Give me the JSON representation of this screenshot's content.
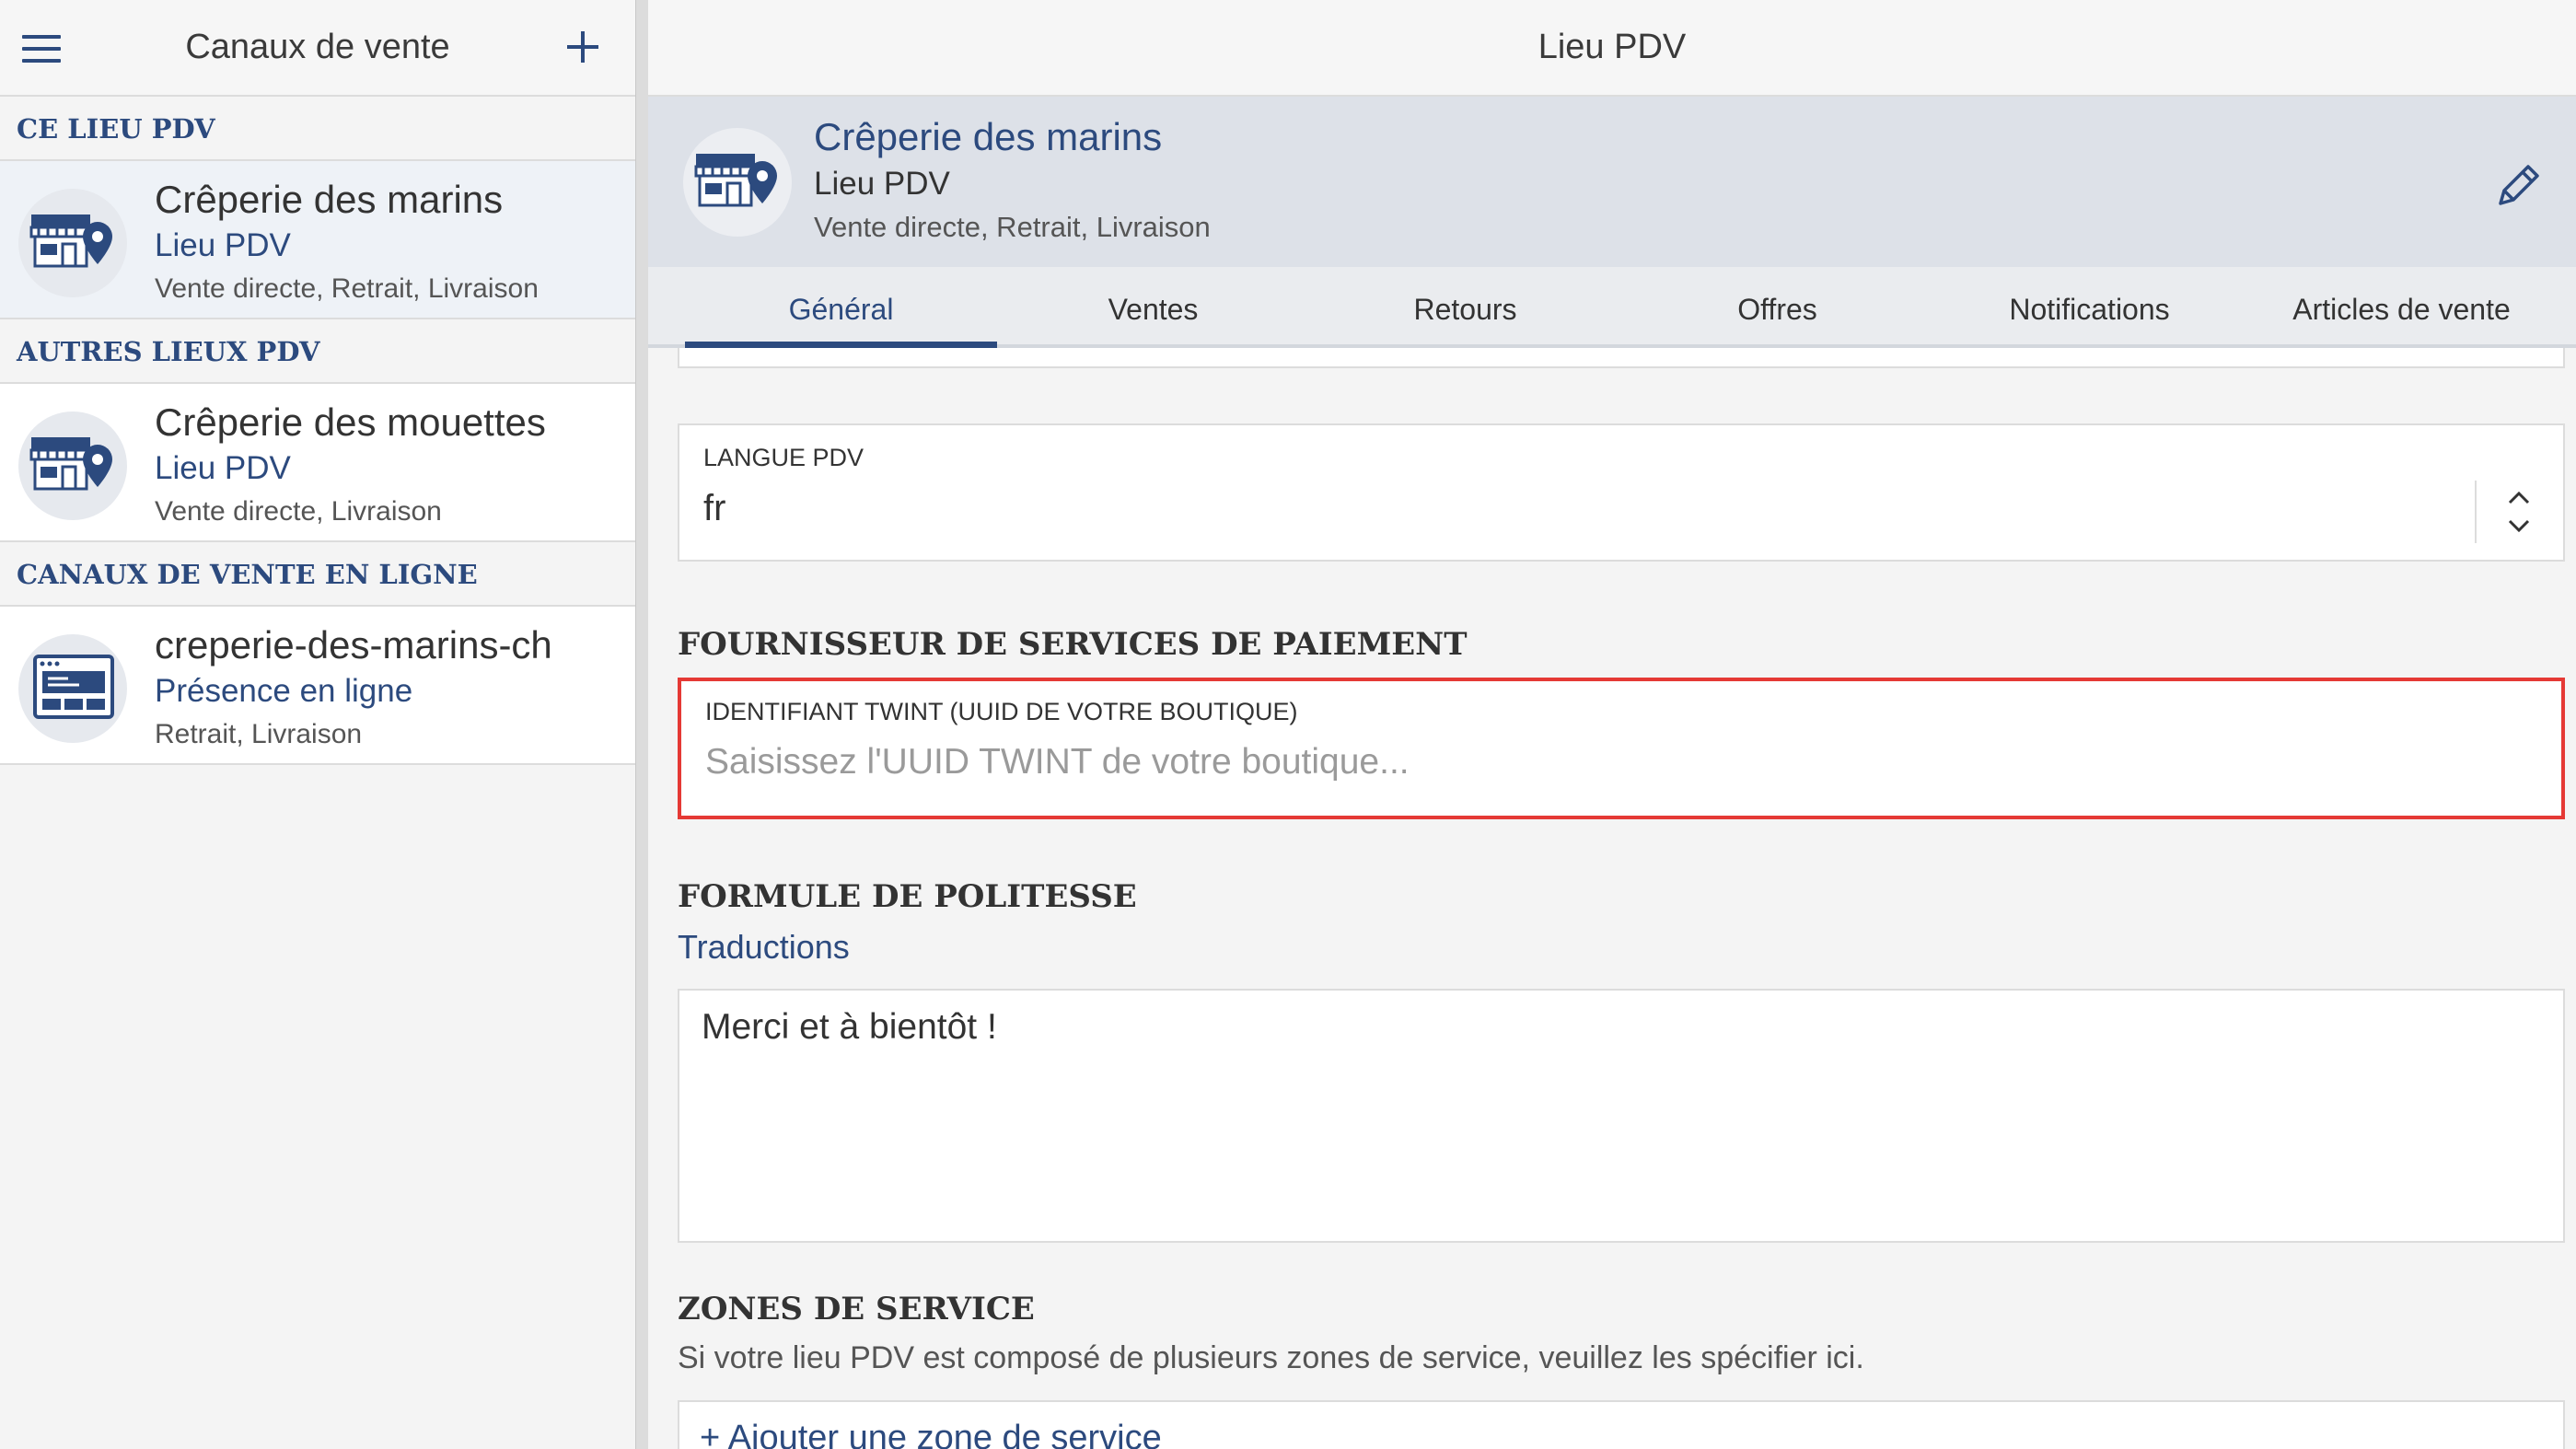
{
  "left": {
    "title": "Canaux de vente",
    "sections": {
      "this_place": "CE LIEU PDV",
      "other_places": "AUTRES LIEUX PDV",
      "online": "CANAUX DE VENTE EN LIGNE"
    },
    "items": [
      {
        "name": "Crêperie des marins",
        "type": "Lieu PDV",
        "modes": "Vente directe, Retrait, Livraison",
        "icon": "store-location-icon"
      },
      {
        "name": "Crêperie des mouettes",
        "type": "Lieu PDV",
        "modes": "Vente directe, Livraison",
        "icon": "store-location-icon"
      },
      {
        "name": "creperie-des-marins-ch",
        "type": "Présence en ligne",
        "modes": "Retrait, Livraison",
        "icon": "browser-window-icon"
      }
    ]
  },
  "right": {
    "title": "Lieu PDV",
    "banner": {
      "name": "Crêperie des marins",
      "type": "Lieu PDV",
      "modes": "Vente directe, Retrait, Livraison"
    },
    "tabs": [
      "Général",
      "Ventes",
      "Retours",
      "Offres",
      "Notifications",
      "Articles de vente"
    ],
    "active_tab": "Général",
    "language": {
      "label": "LANGUE PDV",
      "value": "fr"
    },
    "payment": {
      "title": "FOURNISSEUR DE SERVICES DE PAIEMENT",
      "twint_label": "IDENTIFIANT TWINT (UUID DE VOTRE BOUTIQUE)",
      "twint_placeholder": "Saisissez l'UUID TWINT de votre boutique...",
      "twint_value": ""
    },
    "politesse": {
      "title": "FORMULE DE POLITESSE",
      "translations_link": "Traductions",
      "value": "Merci et à bientôt !"
    },
    "zones": {
      "title": "ZONES DE SERVICE",
      "description": "Si votre lieu PDV est composé de plusieurs zones de service, veuillez les spécifier ici.",
      "add_label": "+ Ajouter une zone de service"
    }
  },
  "colors": {
    "accent": "#2c4a7e",
    "highlight_border": "#e53935",
    "banner_bg": "#dde1e8"
  }
}
